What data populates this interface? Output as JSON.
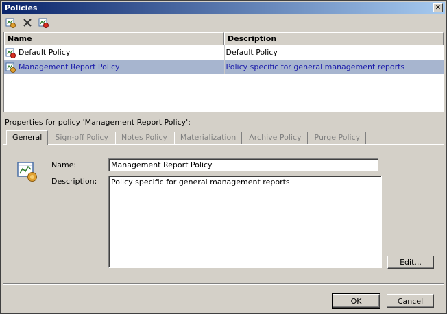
{
  "window": {
    "title": "Policies",
    "close_glyph": "✕"
  },
  "toolbar": {
    "buttons": [
      "add-policy-icon",
      "delete-icon",
      "edit-policy-icon"
    ]
  },
  "table": {
    "columns": [
      "Name",
      "Description"
    ],
    "rows": [
      {
        "name": "Default Policy",
        "description": "Default Policy",
        "icon": "default-policy-icon",
        "selected": false
      },
      {
        "name": "Management Report Policy",
        "description": "Policy specific for general management reports",
        "icon": "policy-icon",
        "selected": true
      }
    ]
  },
  "properties": {
    "caption": "Properties for policy 'Management Report Policy':",
    "tabs": [
      "General",
      "Sign-off Policy",
      "Notes Policy",
      "Materialization",
      "Archive Policy",
      "Purge Policy"
    ],
    "active_tab": "General",
    "name_label": "Name:",
    "name_value": "Management Report Policy",
    "description_label": "Description:",
    "description_value": "Policy specific for general management reports",
    "edit_button": "Edit..."
  },
  "footer": {
    "ok": "OK",
    "cancel": "Cancel"
  },
  "colors": {
    "selection": "#a7b5cf",
    "selection_text": "#1a1aaa",
    "title_start": "#0a246a"
  }
}
